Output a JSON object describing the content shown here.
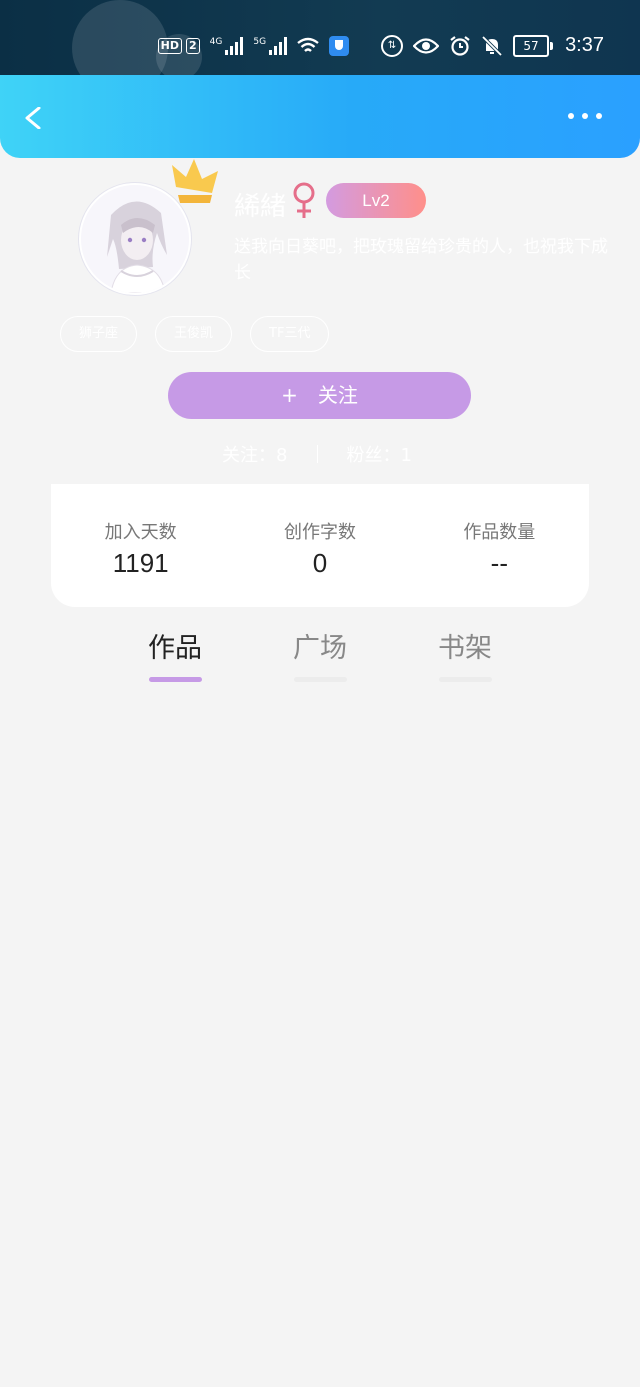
{
  "status_bar": {
    "hd_label": "HD",
    "sim_label": "2",
    "net1_label": "4G",
    "net2_label": "5G",
    "battery": "57",
    "time": "3:37"
  },
  "profile": {
    "username": "絺緒",
    "gender_symbol": "♀",
    "level": "Lv2",
    "bio": "送我向日葵吧，把玫瑰留给珍贵的人，也祝我下成长",
    "tags": [
      "狮子座",
      "王俊凯",
      "TF三代"
    ],
    "follow_button": "关注",
    "following_text": "关注：8",
    "fans_text": "粉丝：1"
  },
  "stats_card": {
    "items": [
      {
        "label": "加入天数",
        "value": "1191"
      },
      {
        "label": "创作字数",
        "value": "0"
      },
      {
        "label": "作品数量",
        "value": "--"
      }
    ]
  },
  "tabs": [
    {
      "label": "作品",
      "active": true
    },
    {
      "label": "广场",
      "active": false
    },
    {
      "label": "书架",
      "active": false
    }
  ],
  "colors": {
    "header_start": "#3fd3f7",
    "header_end": "#2aa0ff",
    "accent": "#c69ae6",
    "level_start": "#d39be0",
    "level_end": "#ff8f8a"
  }
}
